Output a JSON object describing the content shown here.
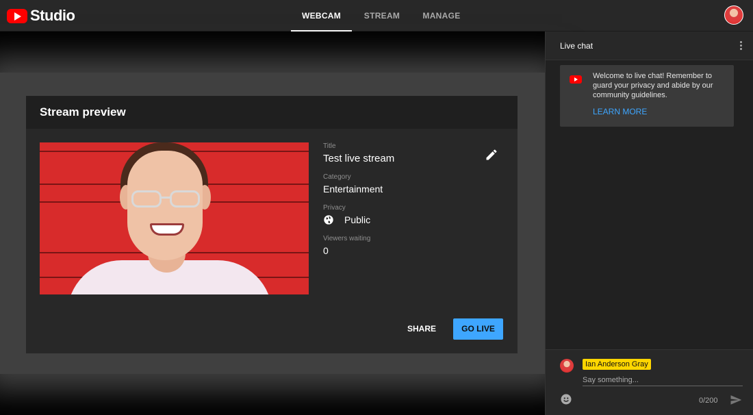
{
  "app": {
    "logo_text": "Studio"
  },
  "tabs": [
    {
      "label": "WEBCAM",
      "active": true
    },
    {
      "label": "STREAM",
      "active": false
    },
    {
      "label": "MANAGE",
      "active": false
    }
  ],
  "preview_card": {
    "heading": "Stream preview",
    "fields": {
      "title_label": "Title",
      "title_value": "Test live stream",
      "category_label": "Category",
      "category_value": "Entertainment",
      "privacy_label": "Privacy",
      "privacy_value": "Public",
      "viewers_label": "Viewers waiting",
      "viewers_value": "0"
    },
    "share_label": "SHARE",
    "go_live_label": "GO LIVE"
  },
  "chat": {
    "header": "Live chat",
    "welcome_text": "Welcome to live chat! Remember to guard your privacy and abide by our community guidelines.",
    "learn_more": "LEARN MORE",
    "username": "Ian Anderson Gray",
    "input_placeholder": "Say something...",
    "char_count": "0/200"
  },
  "colors": {
    "accent_blue": "#3ea6ff",
    "brand_red": "#ff0000",
    "username_highlight": "#ffd600"
  },
  "icons": [
    "youtube-logo-icon",
    "avatar",
    "edit-pencil-icon",
    "globe-icon",
    "more-vert-icon",
    "youtube-icon",
    "emoji-icon",
    "send-icon"
  ]
}
